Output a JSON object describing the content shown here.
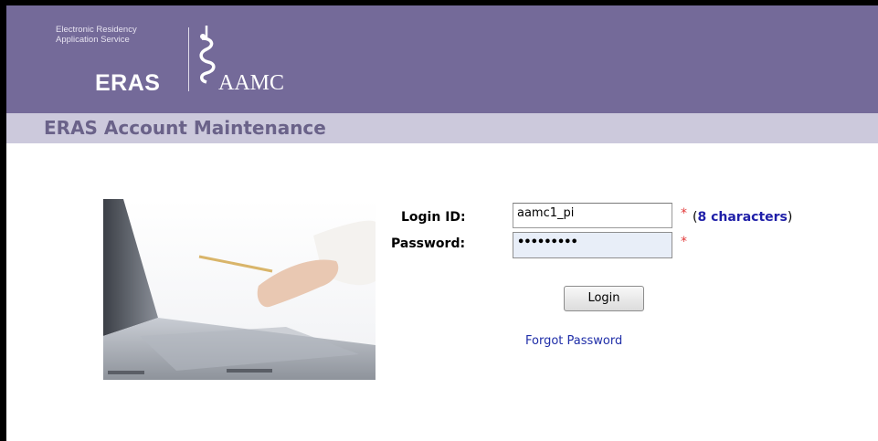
{
  "header": {
    "logo_line1": "Electronic Residency",
    "logo_line2": "Application Service",
    "logo_eras": "ERAS",
    "logo_aamc": "AAMC",
    "background_color": "#746a99"
  },
  "page_title": "ERAS Account Maintenance",
  "login_form": {
    "login_id_label": "Login ID:",
    "login_id_value": "aamc1_pi",
    "password_label": "Password:",
    "password_value": "•••••••••",
    "required_mark": "*",
    "hint_open": "(",
    "hint_text": "8 characters",
    "hint_close": ")",
    "login_button": "Login",
    "forgot_password": "Forgot Password"
  }
}
